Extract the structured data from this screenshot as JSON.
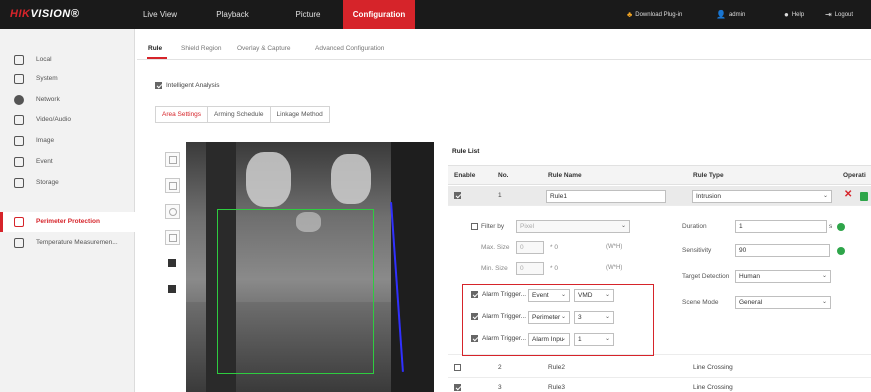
{
  "header": {
    "logo_brand": "HIK",
    "logo_rest": "VISION",
    "nav": [
      {
        "label": "Live View"
      },
      {
        "label": "Playback"
      },
      {
        "label": "Picture"
      },
      {
        "label": "Configuration"
      }
    ],
    "download_plugin": "Download Plug-in",
    "user": "admin",
    "help": "Help",
    "logout": "Logout",
    "colors": {
      "accent": "#d6242a",
      "bar": "#1a1a1a"
    }
  },
  "sidebar": {
    "items": [
      {
        "label": "Local",
        "icon": "monitor-icon"
      },
      {
        "label": "System",
        "icon": "system-icon"
      },
      {
        "label": "Network",
        "icon": "globe-icon"
      },
      {
        "label": "Video/Audio",
        "icon": "video-audio-icon"
      },
      {
        "label": "Image",
        "icon": "image-icon"
      },
      {
        "label": "Event",
        "icon": "event-icon"
      },
      {
        "label": "Storage",
        "icon": "storage-icon"
      },
      {
        "label": "Perimeter Protection",
        "icon": "perimeter-icon"
      },
      {
        "label": "Temperature Measuremen...",
        "icon": "thermometer-icon"
      }
    ]
  },
  "tabs": [
    {
      "label": "Rule"
    },
    {
      "label": "Shield Region"
    },
    {
      "label": "Overlay & Capture"
    },
    {
      "label": "Advanced Configuration"
    }
  ],
  "intelligent_analysis": {
    "label": "Intelligent Analysis",
    "checked": true
  },
  "subtabs": [
    {
      "label": "Area Settings"
    },
    {
      "label": "Arming Schedule"
    },
    {
      "label": "Linkage Method"
    }
  ],
  "rule_list": {
    "title": "Rule List",
    "columns": {
      "enable": "Enable",
      "no": "No.",
      "name": "Rule Name",
      "type": "Rule Type",
      "operation": "Operati"
    },
    "selected": {
      "no": "1",
      "name": "Rule1",
      "type": "Intrusion"
    },
    "rows": [
      {
        "no": "2",
        "name": "Rule2",
        "type": "Line Crossing"
      },
      {
        "no": "3",
        "name": "Rule3",
        "type": "Line Crossing"
      }
    ]
  },
  "detail": {
    "filter_by_label": "Filter by",
    "filter_by_value": "Pixel",
    "max_size_label": "Max. Size",
    "max_w": "0",
    "max_h": "0",
    "min_size_label": "Min. Size",
    "min_w": "0",
    "min_h": "0",
    "size_sep": "* 0",
    "unit": "(W*H)",
    "duration_label": "Duration",
    "duration_value": "1",
    "duration_unit": "s",
    "sensitivity_label": "Sensitivity",
    "sensitivity_value": "90",
    "target_detection_label": "Target Detection",
    "target_detection_value": "Human",
    "scene_mode_label": "Scene Mode",
    "scene_mode_value": "General"
  },
  "alarm_triggers": [
    {
      "label": "Alarm Trigger...",
      "type": "Event",
      "value": "VMD"
    },
    {
      "label": "Alarm Trigger...",
      "type": "Perimeter",
      "value": "3"
    },
    {
      "label": "Alarm Trigger...",
      "type": "Alarm Inpu",
      "value": "1"
    }
  ]
}
